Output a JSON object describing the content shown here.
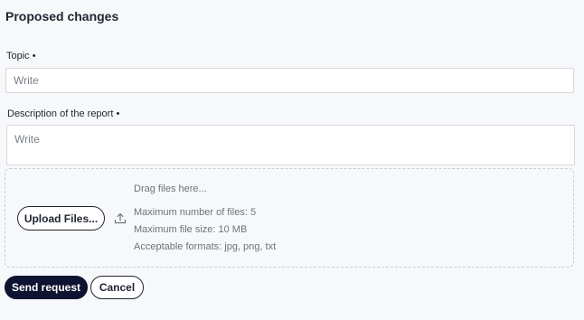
{
  "form": {
    "title": "Proposed changes",
    "topic": {
      "label": "Topic •",
      "placeholder": "Write",
      "value": ""
    },
    "description": {
      "label": "Description of the report •",
      "placeholder": "Write",
      "value": ""
    },
    "upload": {
      "button_label": "Upload Files...",
      "icon": "upload-icon",
      "drag_text": "Drag files here...",
      "max_files": "Maximum number of files: 5",
      "max_size": "Maximum file size: 10 MB",
      "formats": "Acceptable formats: jpg, png, txt"
    },
    "actions": {
      "send_label": "Send request",
      "cancel_label": "Cancel"
    }
  },
  "colors": {
    "background": "#f7f8fa",
    "primary_button": "#0d1330",
    "text": "#1f2430",
    "muted_text": "#6d727b",
    "border": "#d5d8de"
  }
}
